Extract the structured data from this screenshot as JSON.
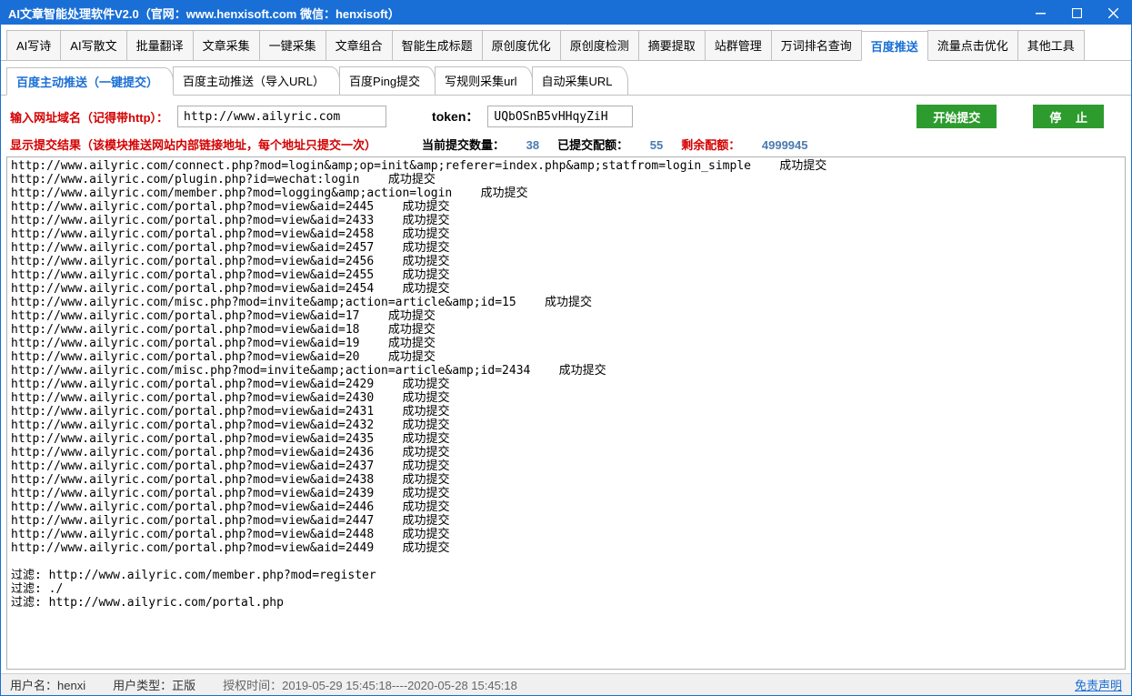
{
  "title": "AI文章智能处理软件V2.0（官网：www.henxisoft.com  微信：henxisoft）",
  "main_tabs": [
    "AI写诗",
    "AI写散文",
    "批量翻译",
    "文章采集",
    "一键采集",
    "文章组合",
    "智能生成标题",
    "原创度优化",
    "原创度检测",
    "摘要提取",
    "站群管理",
    "万词排名查询",
    "百度推送",
    "流量点击优化",
    "其他工具"
  ],
  "main_tab_active_index": 12,
  "sub_tabs": [
    "百度主动推送（一键提交）",
    "百度主动推送（导入URL）",
    "百度Ping提交",
    "写规则采集url",
    "自动采集URL"
  ],
  "sub_tab_active_index": 0,
  "form": {
    "domain_label": "输入网址域名（记得带http）：",
    "domain_value": "http://www.ailyric.com",
    "token_label": "token：",
    "token_value": "UQbOSnB5vHHqyZiH",
    "start_btn": "开始提交",
    "stop_btn": "停 止"
  },
  "status": {
    "result_label": "显示提交结果（该模块推送网站内部链接地址，每个地址只提交一次）",
    "current_label": "当前提交数量：",
    "current_value": "38",
    "submitted_label": "已提交配额：",
    "submitted_value": "55",
    "remain_label": "剩余配额：",
    "remain_value": "4999945"
  },
  "log_lines": [
    "http://www.ailyric.com/connect.php?mod=login&amp;op=init&amp;referer=index.php&amp;statfrom=login_simple    成功提交",
    "http://www.ailyric.com/plugin.php?id=wechat:login    成功提交",
    "http://www.ailyric.com/member.php?mod=logging&amp;action=login    成功提交",
    "http://www.ailyric.com/portal.php?mod=view&aid=2445    成功提交",
    "http://www.ailyric.com/portal.php?mod=view&aid=2433    成功提交",
    "http://www.ailyric.com/portal.php?mod=view&aid=2458    成功提交",
    "http://www.ailyric.com/portal.php?mod=view&aid=2457    成功提交",
    "http://www.ailyric.com/portal.php?mod=view&aid=2456    成功提交",
    "http://www.ailyric.com/portal.php?mod=view&aid=2455    成功提交",
    "http://www.ailyric.com/portal.php?mod=view&aid=2454    成功提交",
    "http://www.ailyric.com/misc.php?mod=invite&amp;action=article&amp;id=15    成功提交",
    "http://www.ailyric.com/portal.php?mod=view&aid=17    成功提交",
    "http://www.ailyric.com/portal.php?mod=view&aid=18    成功提交",
    "http://www.ailyric.com/portal.php?mod=view&aid=19    成功提交",
    "http://www.ailyric.com/portal.php?mod=view&aid=20    成功提交",
    "http://www.ailyric.com/misc.php?mod=invite&amp;action=article&amp;id=2434    成功提交",
    "http://www.ailyric.com/portal.php?mod=view&aid=2429    成功提交",
    "http://www.ailyric.com/portal.php?mod=view&aid=2430    成功提交",
    "http://www.ailyric.com/portal.php?mod=view&aid=2431    成功提交",
    "http://www.ailyric.com/portal.php?mod=view&aid=2432    成功提交",
    "http://www.ailyric.com/portal.php?mod=view&aid=2435    成功提交",
    "http://www.ailyric.com/portal.php?mod=view&aid=2436    成功提交",
    "http://www.ailyric.com/portal.php?mod=view&aid=2437    成功提交",
    "http://www.ailyric.com/portal.php?mod=view&aid=2438    成功提交",
    "http://www.ailyric.com/portal.php?mod=view&aid=2439    成功提交",
    "http://www.ailyric.com/portal.php?mod=view&aid=2446    成功提交",
    "http://www.ailyric.com/portal.php?mod=view&aid=2447    成功提交",
    "http://www.ailyric.com/portal.php?mod=view&aid=2448    成功提交",
    "http://www.ailyric.com/portal.php?mod=view&aid=2449    成功提交",
    "",
    "过滤: http://www.ailyric.com/member.php?mod=register",
    "过滤: ./",
    "过滤: http://www.ailyric.com/portal.php"
  ],
  "statusbar": {
    "user_label": "用户名：",
    "user_value": "henxi",
    "type_label": "用户类型：",
    "type_value": "正版",
    "auth_label": "授权时间：",
    "auth_value": "2019-05-29 15:45:18----2020-05-28 15:45:18",
    "disclaimer": "免责声明"
  }
}
